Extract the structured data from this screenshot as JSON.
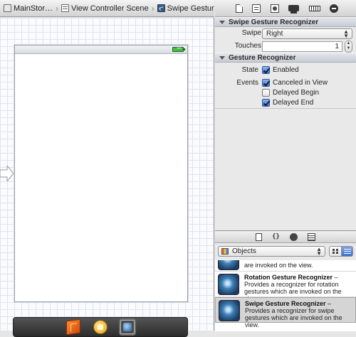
{
  "breadcrumb": [
    {
      "label": "MainStor…",
      "icon": "storyboard-file-icon"
    },
    {
      "label": "View Controller Scene",
      "icon": "scene-icon"
    },
    {
      "label": "Swipe Gesture Recognizer",
      "icon": "swipe-gesture-icon"
    }
  ],
  "inspector": {
    "toolbar_icons": [
      "file-inspector-icon",
      "quick-help-icon",
      "identity-inspector-icon",
      "attributes-inspector-icon",
      "size-inspector-icon",
      "connections-inspector-icon"
    ],
    "swipe_section": {
      "title": "Swipe Gesture Recognizer",
      "swipe_label": "Swipe",
      "swipe_value": "Right",
      "touches_label": "Touches",
      "touches_value": "1"
    },
    "gesture_section": {
      "title": "Gesture Recognizer",
      "state_label": "State",
      "enabled_label": "Enabled",
      "enabled_checked": true,
      "events_label": "Events",
      "canceled_label": "Canceled in View",
      "canceled_checked": true,
      "delayed_begin_label": "Delayed Begin",
      "delayed_begin_checked": false,
      "delayed_end_label": "Delayed End",
      "delayed_end_checked": true
    }
  },
  "library": {
    "tab_icons": [
      "file-template-icon",
      "code-snippet-icon",
      "object-library-icon",
      "media-library-icon"
    ],
    "filter_value": "Objects",
    "items": [
      {
        "title": "",
        "desc": "are invoked on the view."
      },
      {
        "title": "Rotation Gesture Recognizer",
        "desc": "Provides a recognizer for rotation gestures which are invoked on the view."
      },
      {
        "title": "Swipe Gesture Recognizer",
        "desc": "Provides a recognizer for swipe gestures which are invoked on the view."
      }
    ]
  },
  "dock_icons": [
    "view-controller-icon",
    "first-responder-icon",
    "swipe-gesture-recognizer-icon"
  ]
}
